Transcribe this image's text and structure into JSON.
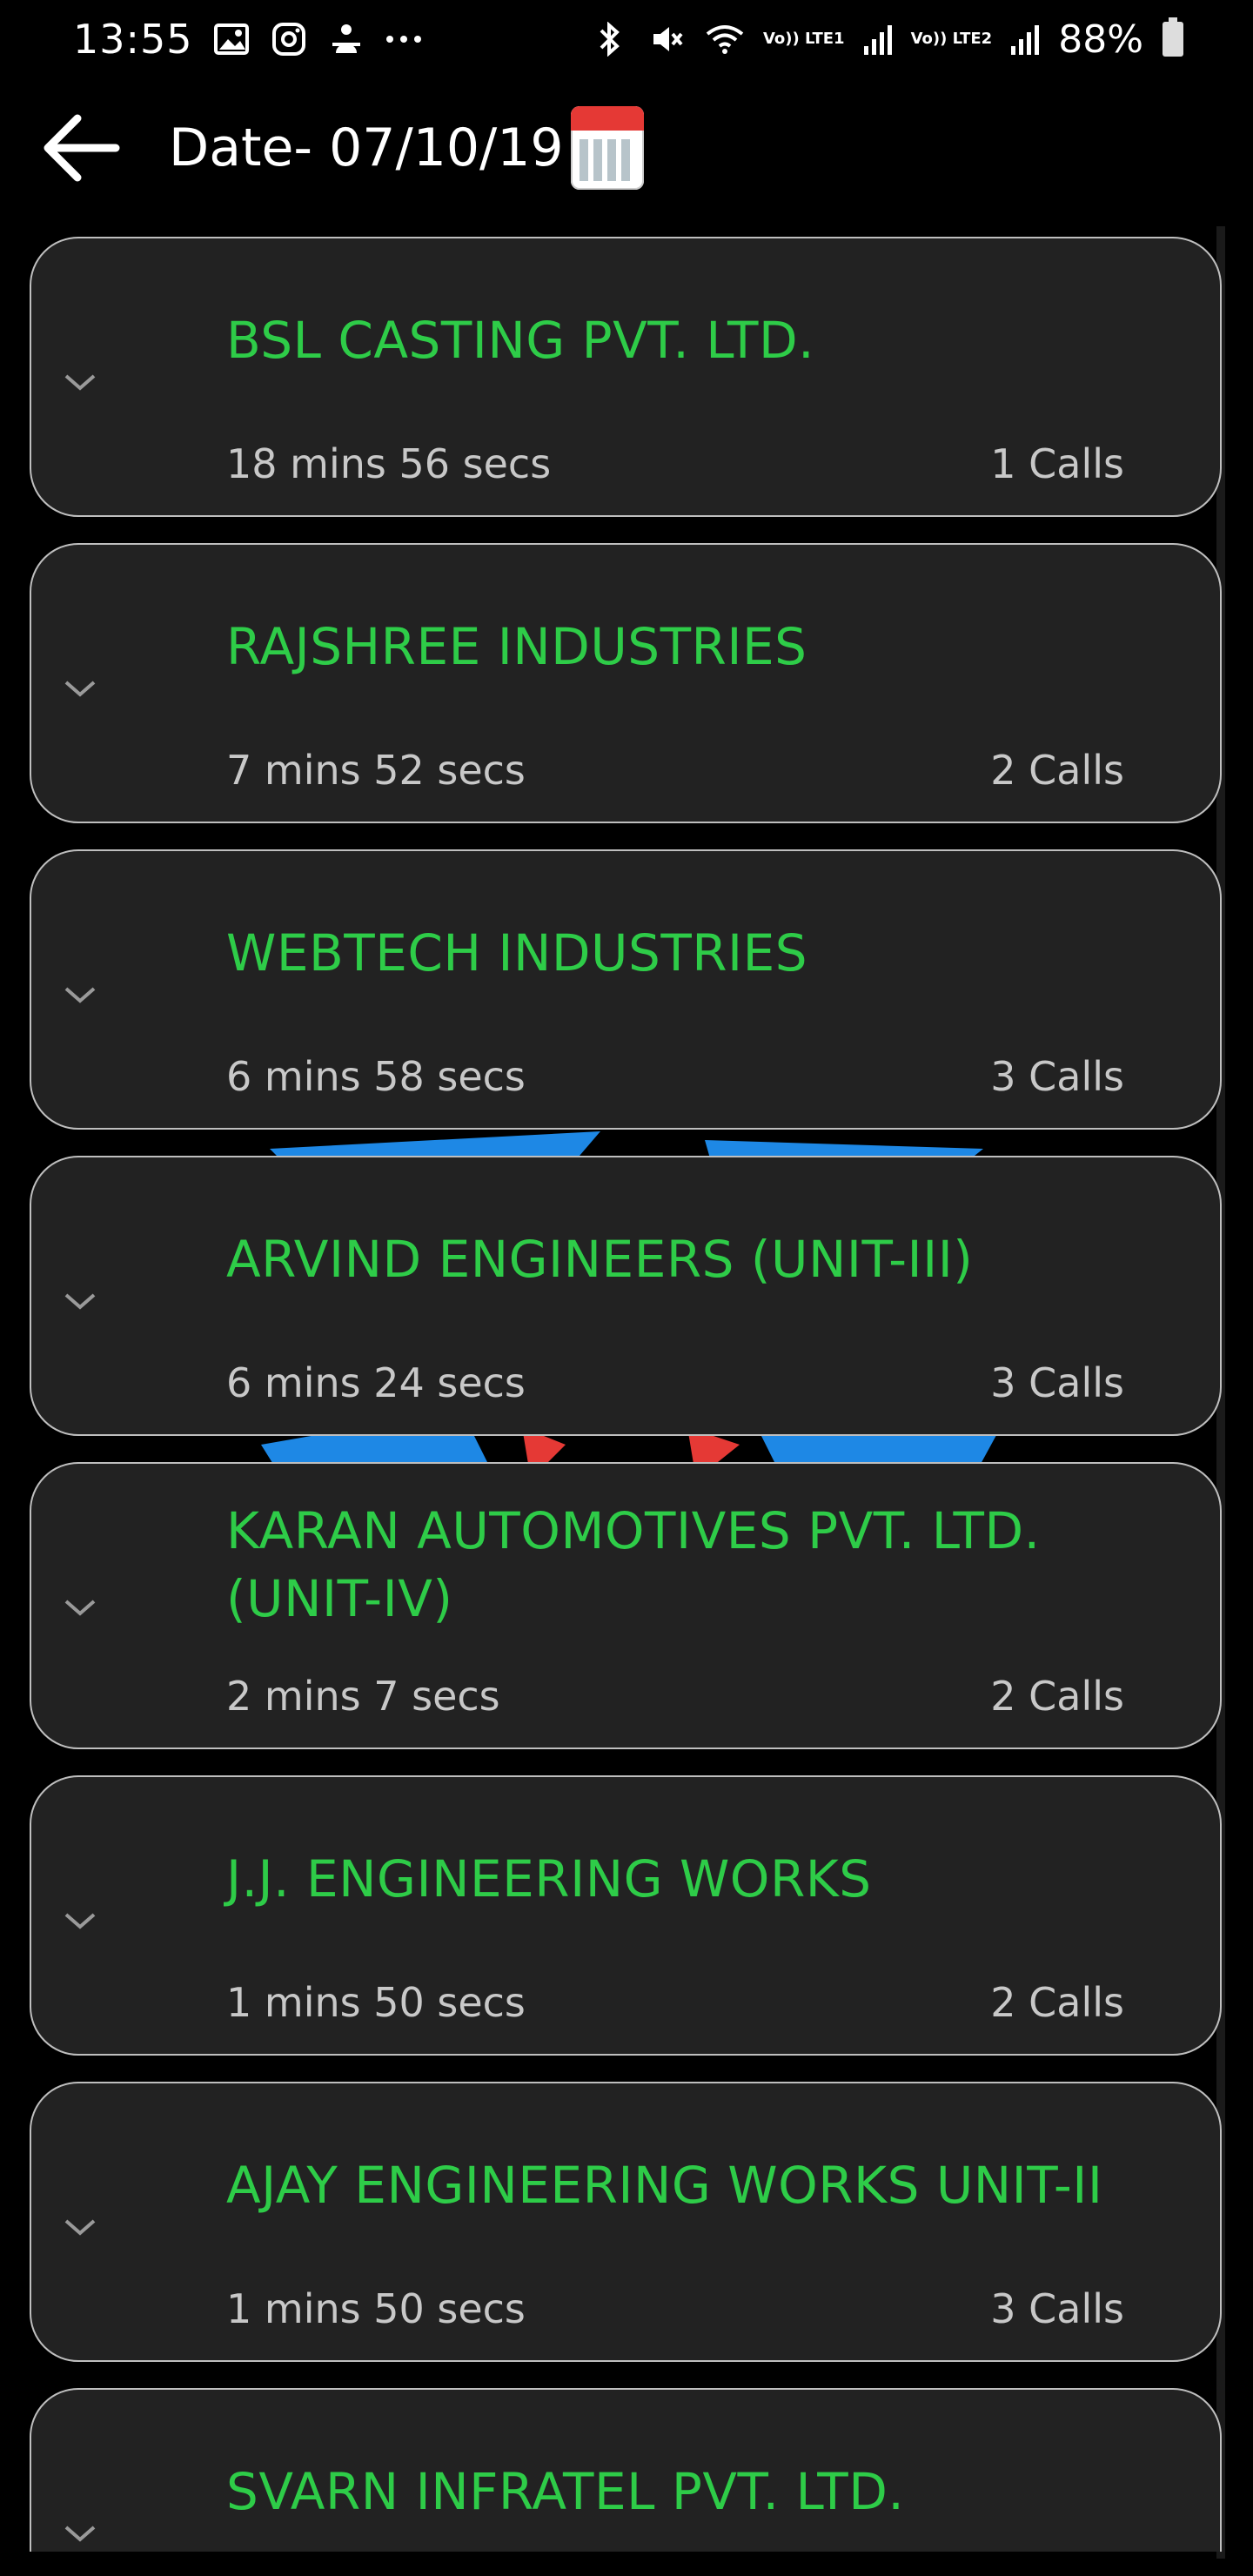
{
  "status_bar": {
    "time": "13:55",
    "lte1_label": "Vo)) LTE1",
    "lte2_label": "Vo)) LTE2",
    "battery": "88%",
    "left_icons": [
      "gallery-icon",
      "instagram-icon",
      "notification-app-icon",
      "more-dots-icon"
    ],
    "right_icons": [
      "bluetooth-icon",
      "mute-icon",
      "wifi-icon",
      "signal-icon",
      "battery-icon"
    ]
  },
  "header": {
    "title": "Date- 07/10/19",
    "back_icon": "arrow-left-icon",
    "calendar_icon": "calendar-icon"
  },
  "colors": {
    "background": "#000000",
    "card_background": "#222222",
    "card_border": "#bfbfbf",
    "company_name": "#2ecc48",
    "meta_text": "#c8c8c8"
  },
  "entries": [
    {
      "name": "BSL CASTING PVT. LTD.",
      "duration": "18 mins 56 secs",
      "calls": "1 Calls"
    },
    {
      "name": "RAJSHREE INDUSTRIES",
      "duration": "7 mins 52 secs",
      "calls": "2 Calls"
    },
    {
      "name": "WEBTECH INDUSTRIES",
      "duration": "6 mins 58 secs",
      "calls": "3 Calls"
    },
    {
      "name": "ARVIND ENGINEERS (UNIT-III)",
      "duration": "6 mins 24 secs",
      "calls": "3 Calls"
    },
    {
      "name": "KARAN AUTOMOTIVES PVT. LTD. (UNIT-IV)",
      "duration": "2 mins 7 secs",
      "calls": "2 Calls"
    },
    {
      "name": "J.J. ENGINEERING WORKS",
      "duration": "1 mins 50 secs",
      "calls": "2 Calls"
    },
    {
      "name": "AJAY ENGINEERING WORKS UNIT-II",
      "duration": "1 mins 50 secs",
      "calls": "3 Calls"
    },
    {
      "name": "SVARN INFRATEL PVT. LTD.",
      "duration": "",
      "calls": ""
    }
  ]
}
